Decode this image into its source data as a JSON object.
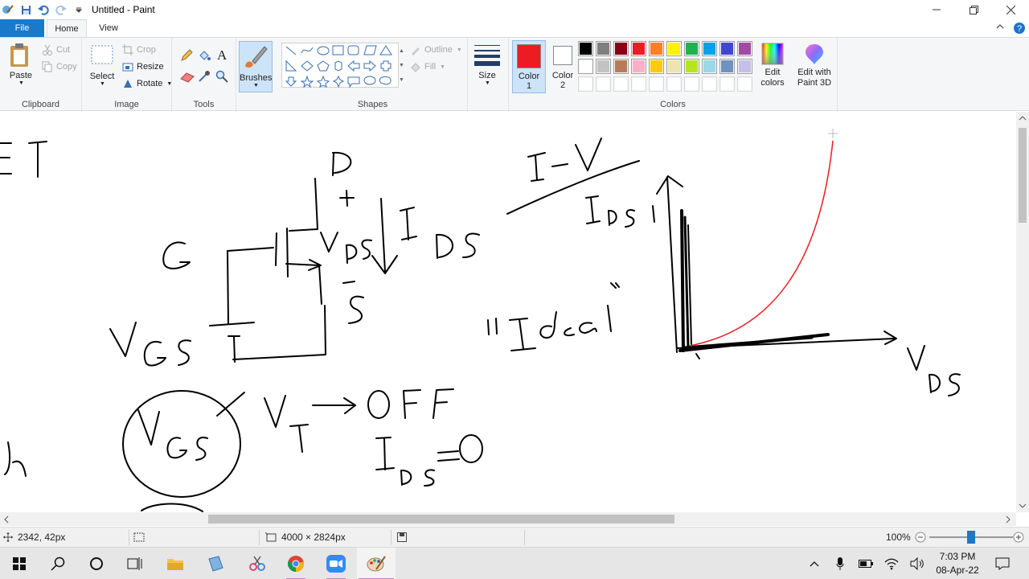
{
  "window": {
    "title": "Untitled - Paint"
  },
  "tabs": [
    {
      "label": "File"
    },
    {
      "label": "Home"
    },
    {
      "label": "View"
    }
  ],
  "ribbon": {
    "clipboard": {
      "label": "Clipboard",
      "paste": "Paste",
      "cut": "Cut",
      "copy": "Copy"
    },
    "image": {
      "label": "Image",
      "select": "Select",
      "crop": "Crop",
      "resize": "Resize",
      "rotate": "Rotate"
    },
    "tools": {
      "label": "Tools"
    },
    "brushes": {
      "label": "Brushes"
    },
    "shapes": {
      "label": "Shapes",
      "outline": "Outline",
      "fill": "Fill"
    },
    "size": {
      "label": "Size"
    },
    "colors": {
      "label": "Colors",
      "color1": {
        "label": "Color",
        "num": "1",
        "value": "#ed1c24"
      },
      "color2": {
        "label": "Color",
        "num": "2",
        "value": "#ffffff"
      },
      "palette_row1": [
        "#000000",
        "#7f7f7f",
        "#880015",
        "#ed1c24",
        "#ff7f27",
        "#fff200",
        "#22b14c",
        "#00a2e8",
        "#3f48cc",
        "#a349a4"
      ],
      "palette_row2": [
        "#ffffff",
        "#c3c3c3",
        "#b97a57",
        "#ffaec9",
        "#ffc90e",
        "#efe4b0",
        "#b5e61d",
        "#99d9ea",
        "#7092be",
        "#c8bfe7"
      ],
      "edit_colors": "Edit colors"
    },
    "paint3d": {
      "label": "Edit with Paint 3D"
    }
  },
  "status": {
    "cursor_pos": "2342, 42px",
    "selection_size": "",
    "image_size": "4000 × 2824px",
    "zoom": "100%",
    "zoom_level": 0.5
  },
  "taskbar": {
    "time": "7:03 PM",
    "date": "08-Apr-22"
  }
}
